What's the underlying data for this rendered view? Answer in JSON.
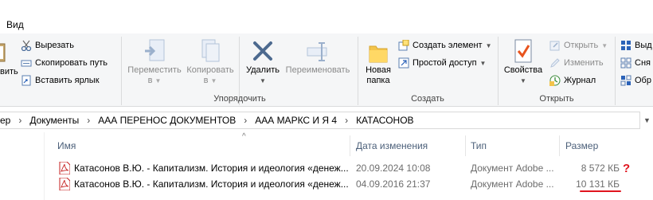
{
  "tabs": {
    "view": "Вид"
  },
  "ribbon": {
    "clipboard": {
      "cut": "Вырезать",
      "copy_path": "Скопировать путь",
      "paste_shortcut": "Вставить ярлык",
      "paste_partial": "вить"
    },
    "organize": {
      "label": "Упорядочить",
      "move_to": [
        "Переместить",
        "в"
      ],
      "copy_to": [
        "Копировать",
        "в"
      ],
      "delete": "Удалить",
      "rename": "Переименовать"
    },
    "create": {
      "label": "Создать",
      "new_folder": [
        "Новая",
        "папка"
      ],
      "new_item": "Создать элемент",
      "easy_access": "Простой доступ"
    },
    "open": {
      "label": "Открыть",
      "properties": "Свойства",
      "open": "Открыть",
      "edit": "Изменить",
      "history": "Журнал"
    },
    "select": {
      "select_all": "Выд",
      "select_none": "Сня",
      "invert": "Обр"
    }
  },
  "address": {
    "crumbs": [
      "ер",
      "Документы",
      "ААА ПЕРЕНОС ДОКУМЕНТОВ",
      "ААА МАРКС И Я 4",
      "КАТАСОНОВ"
    ]
  },
  "columns": {
    "name": "Имя",
    "date": "Дата изменения",
    "type": "Тип",
    "size": "Размер"
  },
  "files": [
    {
      "name": "Катасонов В.Ю. - Капитализм. История и идеология «денеж...",
      "date": "20.09.2024 10:08",
      "type": "Документ Adobe ...",
      "size": "8 572 КБ",
      "mark": "?"
    },
    {
      "name": "Катасонов В.Ю. - Капитализм. История и идеология «денеж...",
      "date": "04.09.2016 21:37",
      "type": "Документ Adobe ...",
      "size": "10 131 КБ"
    }
  ],
  "colors": {
    "accent": "#0078d7",
    "red_mark": "#e0141e",
    "header_text": "#4c607a"
  }
}
